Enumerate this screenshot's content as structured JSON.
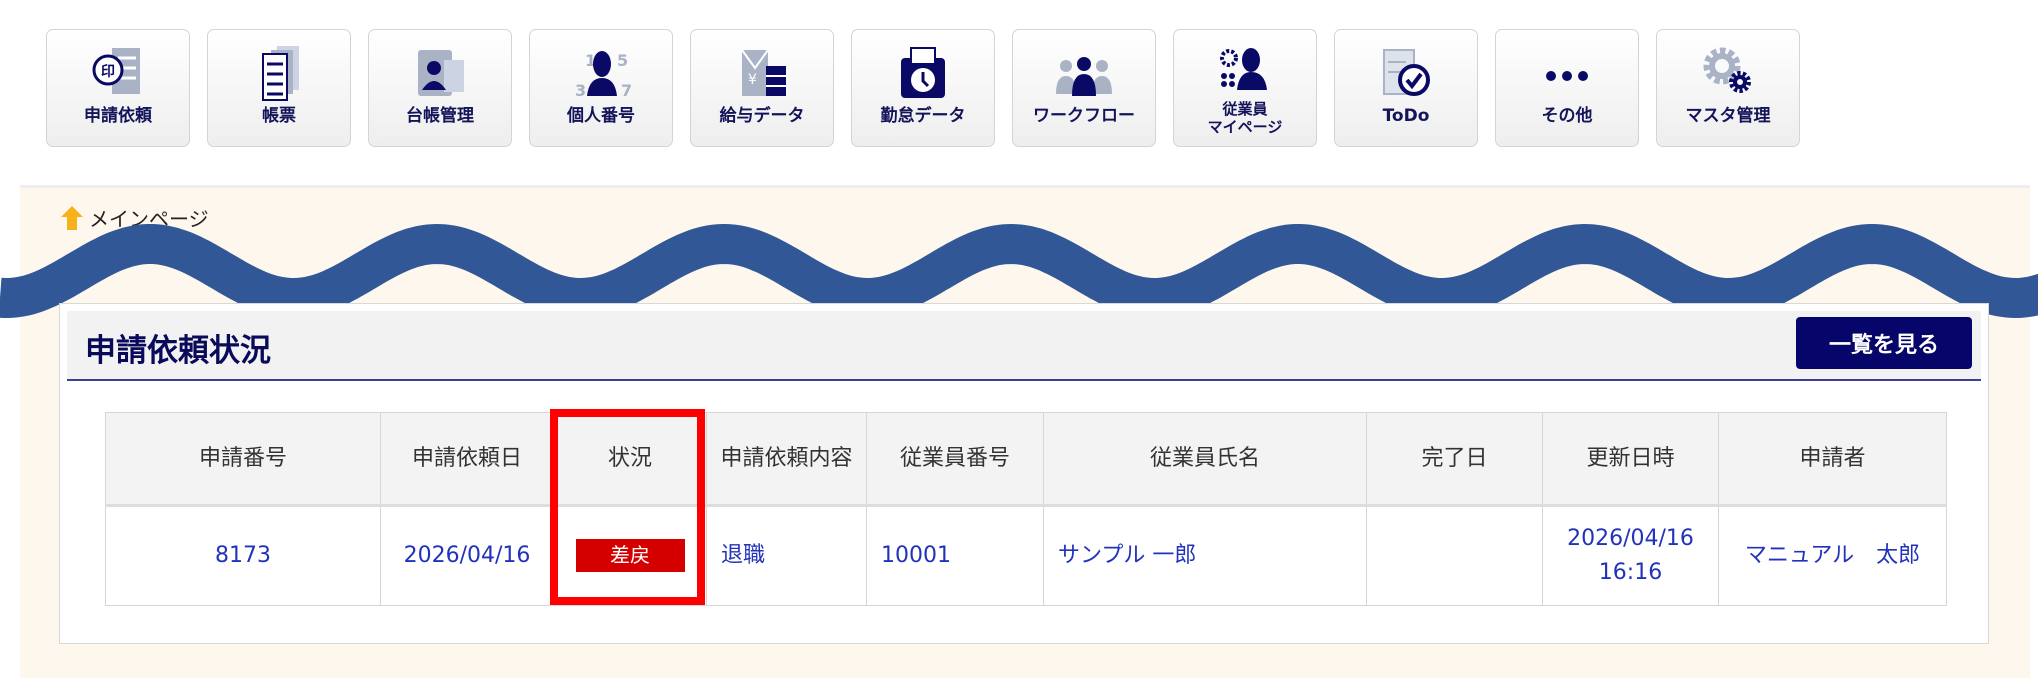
{
  "nav": [
    {
      "label": "申請依頼",
      "icon": "stamp-document-icon"
    },
    {
      "label": "帳票",
      "icon": "documents-icon"
    },
    {
      "label": "台帳管理",
      "icon": "id-card-icon"
    },
    {
      "label": "個人番号",
      "icon": "person-numbers-icon"
    },
    {
      "label": "給与データ",
      "icon": "yen-envelope-icon"
    },
    {
      "label": "勤怠データ",
      "icon": "time-card-icon"
    },
    {
      "label": "ワークフロー",
      "icon": "workflow-people-icon"
    },
    {
      "label": "従業員\nマイページ",
      "icon": "employee-gear-icon"
    },
    {
      "label": "ToDo",
      "icon": "todo-check-icon"
    },
    {
      "label": "その他",
      "icon": "more-dots-icon"
    },
    {
      "label": "マスタ管理",
      "icon": "gears-icon"
    }
  ],
  "breadcrumb": {
    "home": "メインページ"
  },
  "panel": {
    "title": "申請依頼状況",
    "list_button": "一覧を見る"
  },
  "table": {
    "headers": [
      "申請番号",
      "申請依頼日",
      "状況",
      "申請依頼内容",
      "従業員番号",
      "従業員氏名",
      "完了日",
      "更新日時",
      "申請者"
    ],
    "rows": [
      {
        "no": "8173",
        "date": "2026/04/16",
        "status": "差戻",
        "content": "退職",
        "emp_no": "10001",
        "emp_name": "サンプル 一郎",
        "done": "",
        "updated": "2026/04/16\n16:16",
        "applicant": "マニュアル　太郎"
      }
    ]
  },
  "colors": {
    "navy": "#06066a",
    "link": "#2233bb",
    "badge": "#d40000",
    "wave": "#315796",
    "highlight": "#ff0000"
  }
}
